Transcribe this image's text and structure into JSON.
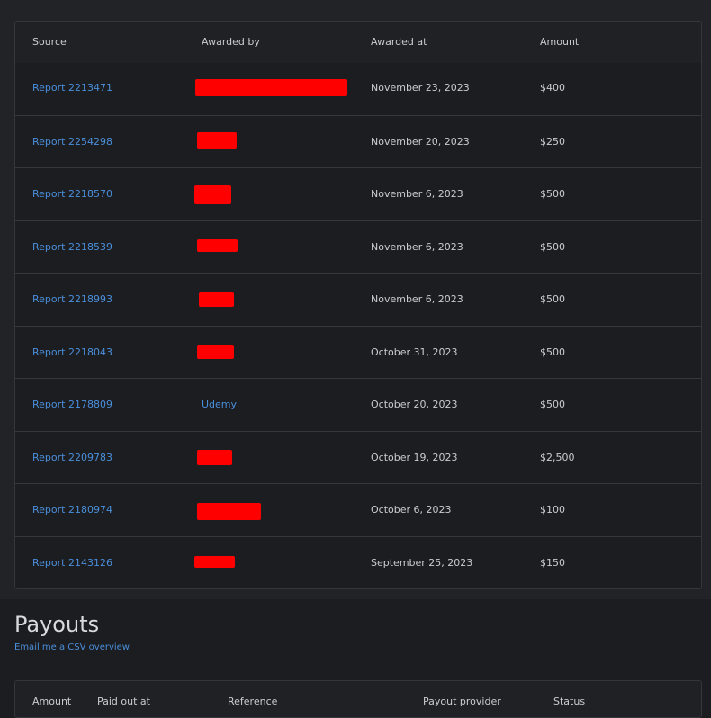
{
  "awards_table": {
    "columns": [
      "Source",
      "Awarded by",
      "Awarded at",
      "Amount"
    ],
    "rows": [
      {
        "source": "Report 2213471",
        "awarded_by": "",
        "awarded_by_redacted": true,
        "awarded_at": "November 23, 2023",
        "amount": "$400"
      },
      {
        "source": "Report 2254298",
        "awarded_by": "",
        "awarded_by_redacted": true,
        "awarded_at": "November 20, 2023",
        "amount": "$250"
      },
      {
        "source": "Report 2218570",
        "awarded_by": "",
        "awarded_by_redacted": true,
        "awarded_at": "November 6, 2023",
        "amount": "$500"
      },
      {
        "source": "Report 2218539",
        "awarded_by": "",
        "awarded_by_redacted": true,
        "awarded_at": "November 6, 2023",
        "amount": "$500"
      },
      {
        "source": "Report 2218993",
        "awarded_by": "",
        "awarded_by_redacted": true,
        "awarded_at": "November 6, 2023",
        "amount": "$500"
      },
      {
        "source": "Report 2218043",
        "awarded_by": "",
        "awarded_by_redacted": true,
        "awarded_at": "October 31, 2023",
        "amount": "$500"
      },
      {
        "source": "Report 2178809",
        "awarded_by": "Udemy",
        "awarded_by_redacted": false,
        "awarded_at": "October 20, 2023",
        "amount": "$500"
      },
      {
        "source": "Report 2209783",
        "awarded_by": "",
        "awarded_by_redacted": true,
        "awarded_at": "October 19, 2023",
        "amount": "$2,500"
      },
      {
        "source": "Report 2180974",
        "awarded_by": "",
        "awarded_by_redacted": true,
        "awarded_at": "October 6, 2023",
        "amount": "$100"
      },
      {
        "source": "Report 2143126",
        "awarded_by": "",
        "awarded_by_redacted": true,
        "awarded_at": "September 25, 2023",
        "amount": "$150"
      }
    ]
  },
  "payouts": {
    "title": "Payouts",
    "email_link": "Email me a CSV overview",
    "columns": [
      "Amount",
      "Paid out at",
      "Reference",
      "Payout provider",
      "Status"
    ]
  },
  "colors": {
    "link": "#4a8fdb",
    "redaction": "#ff0000",
    "background": "#1c1d20"
  }
}
